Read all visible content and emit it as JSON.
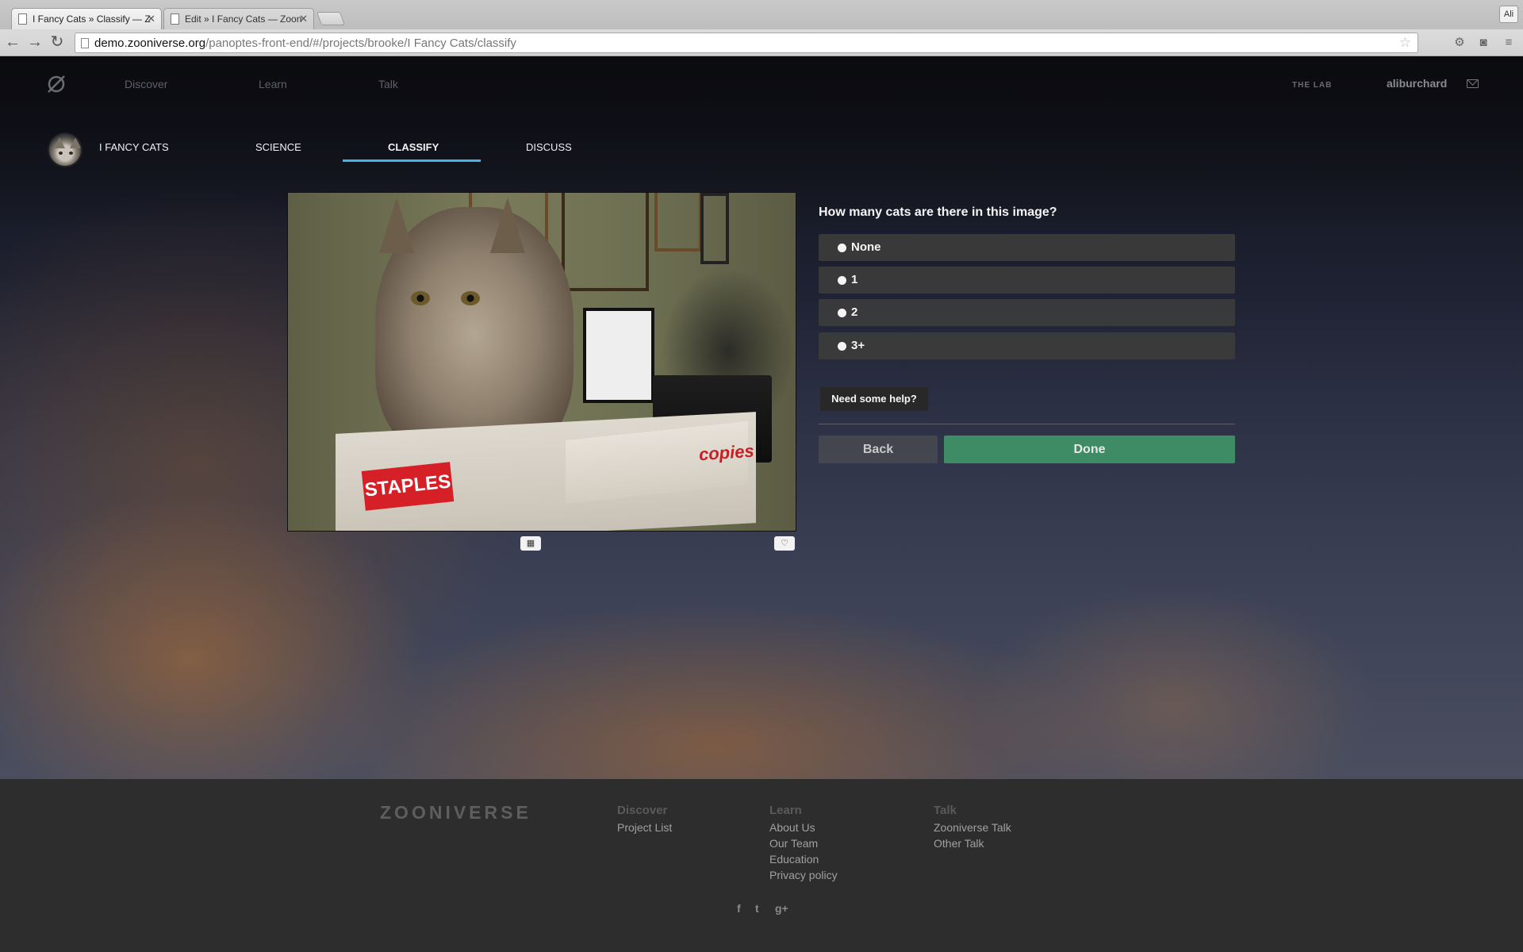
{
  "browser": {
    "tabs": [
      {
        "title": "I Fancy Cats » Classify — Z",
        "active": true
      },
      {
        "title": "Edit » I Fancy Cats — Zoon",
        "active": false
      }
    ],
    "profile": "Ali",
    "url_host": "demo.zooniverse.org",
    "url_path": "/panoptes-front-end/#/projects/brooke/I Fancy Cats/classify"
  },
  "site_nav": {
    "links": [
      "Discover",
      "Learn",
      "Talk"
    ],
    "lab": "THE LAB",
    "username": "aliburchard"
  },
  "project_nav": {
    "title": "I FANCY CATS",
    "tabs": [
      "SCIENCE",
      "CLASSIFY",
      "DISCUSS"
    ],
    "active_tab": "CLASSIFY"
  },
  "subject": {
    "box_brand": "STAPLES",
    "box_text": "copies"
  },
  "task": {
    "question": "How many cats are there in this image?",
    "answers": [
      "None",
      "1",
      "2",
      "3+"
    ],
    "help": "Need some help?",
    "back": "Back",
    "done": "Done"
  },
  "footer": {
    "logo": "ZOONIVERSE",
    "columns": [
      {
        "heading": "Discover",
        "links": [
          "Project List"
        ]
      },
      {
        "heading": "Learn",
        "links": [
          "About Us",
          "Our Team",
          "Education",
          "Privacy policy"
        ]
      },
      {
        "heading": "Talk",
        "links": [
          "Zooniverse Talk",
          "Other Talk"
        ]
      }
    ],
    "social": [
      "f",
      "t",
      "g+"
    ]
  },
  "colors": {
    "accent_underline": "#43b4e8",
    "done_button": "#3e8c66"
  }
}
